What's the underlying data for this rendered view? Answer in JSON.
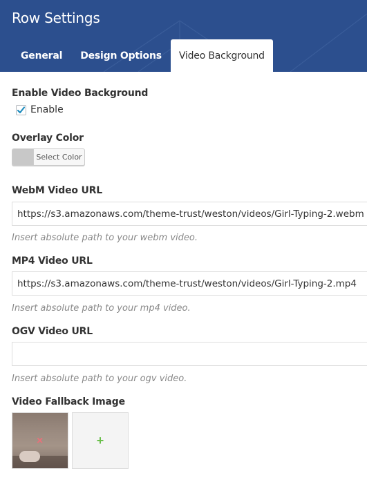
{
  "header": {
    "title": "Row Settings",
    "background_color": "#2c4f8e"
  },
  "tabs": [
    {
      "label": "General",
      "active": false
    },
    {
      "label": "Design Options",
      "active": false
    },
    {
      "label": "Video Background",
      "active": true
    }
  ],
  "enable_video": {
    "label": "Enable Video Background",
    "checkbox_label": "Enable",
    "checked": true,
    "check_color": "#1e8cbe"
  },
  "overlay": {
    "label": "Overlay Color",
    "button_label": "Select Color",
    "swatch_color": "#c8c8c8"
  },
  "webm": {
    "label": "WebM Video URL",
    "value": "https://s3.amazonaws.com/theme-trust/weston/videos/Girl-Typing-2.webm",
    "hint": "Insert absolute path to your webm video."
  },
  "mp4": {
    "label": "MP4 Video URL",
    "value": "https://s3.amazonaws.com/theme-trust/weston/videos/Girl-Typing-2.mp4",
    "hint": "Insert absolute path to your mp4 video."
  },
  "ogv": {
    "label": "OGV Video URL",
    "value": "",
    "hint": "Insert absolute path to your ogv video."
  },
  "fallback": {
    "label": "Video Fallback Image",
    "remove_icon": "×",
    "add_icon": "+"
  }
}
